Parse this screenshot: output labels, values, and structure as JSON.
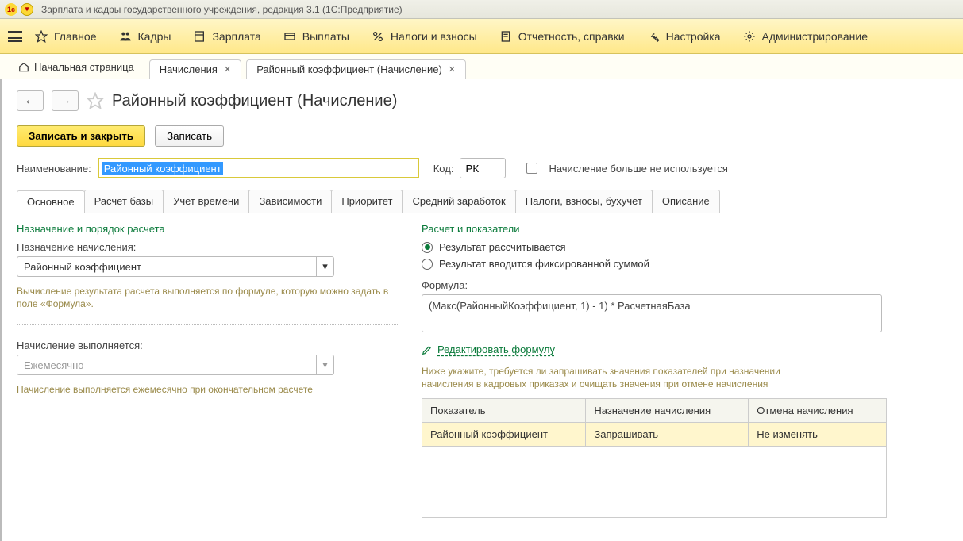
{
  "titlebar": {
    "title": "Зарплата и кадры государственного учреждения, редакция 3.1  (1С:Предприятие)"
  },
  "mainmenu": {
    "items": [
      {
        "label": "Главное"
      },
      {
        "label": "Кадры"
      },
      {
        "label": "Зарплата"
      },
      {
        "label": "Выплаты"
      },
      {
        "label": "Налоги и взносы"
      },
      {
        "label": "Отчетность, справки"
      },
      {
        "label": "Настройка"
      },
      {
        "label": "Администрирование"
      }
    ]
  },
  "tabs": {
    "home": "Начальная страница",
    "items": [
      {
        "label": "Начисления"
      },
      {
        "label": "Районный коэффициент (Начисление)"
      }
    ]
  },
  "page": {
    "title": "Районный коэффициент (Начисление)",
    "save_close": "Записать и закрыть",
    "save": "Записать",
    "name_label": "Наименование:",
    "name_value": "Районный коэффициент",
    "code_label": "Код:",
    "code_value": "РК",
    "unused_label": "Начисление больше не используется"
  },
  "innertabs": [
    "Основное",
    "Расчет базы",
    "Учет времени",
    "Зависимости",
    "Приоритет",
    "Средний заработок",
    "Налоги, взносы, бухучет",
    "Описание"
  ],
  "left": {
    "group1": "Назначение и порядок расчета",
    "assign_label": "Назначение начисления:",
    "assign_value": "Районный коэффициент",
    "assign_help": "Вычисление результата расчета выполняется по формуле, которую можно задать в поле «Формула».",
    "period_label": "Начисление выполняется:",
    "period_value": "Ежемесячно",
    "period_help": "Начисление выполняется ежемесячно при окончательном расчете"
  },
  "right": {
    "group": "Расчет и показатели",
    "r1": "Результат рассчитывается",
    "r2": "Результат вводится фиксированной суммой",
    "formula_label": "Формула:",
    "formula": "(Макс(РайонныйКоэффициент, 1) - 1) * РасчетнаяБаза",
    "edit": "Редактировать формулу",
    "note": "Ниже укажите, требуется ли запрашивать значения показателей при назначении начисления в кадровых приказах и очищать значения при отмене начисления",
    "th1": "Показатель",
    "th2": "Назначение начисления",
    "th3": "Отмена начисления",
    "td1": "Районный коэффициент",
    "td2": "Запрашивать",
    "td3": "Не изменять"
  }
}
